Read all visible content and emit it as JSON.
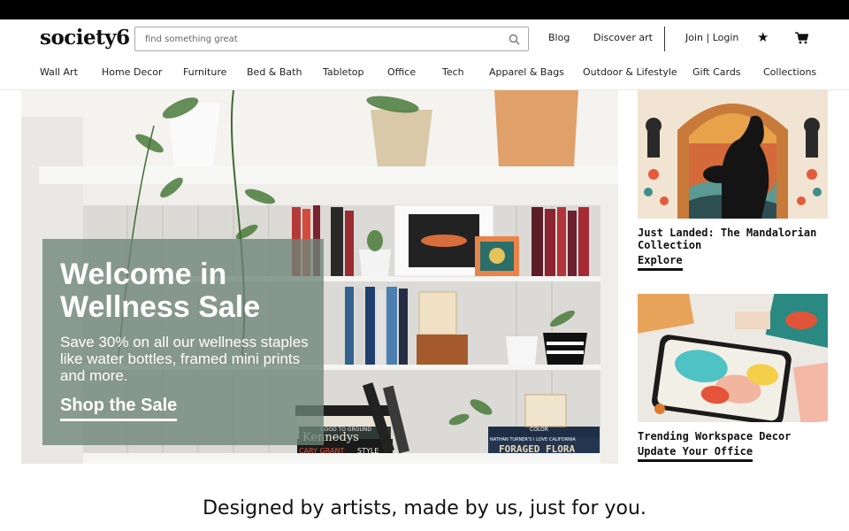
{
  "header": {
    "logo": "society6",
    "search_placeholder": "find something great",
    "links": {
      "blog": "Blog",
      "discover": "Discover art",
      "join": "Join | Login"
    }
  },
  "nav": {
    "items": [
      "Wall Art",
      "Home Decor",
      "Furniture",
      "Bed & Bath",
      "Tabletop",
      "Office",
      "Tech",
      "Apparel & Bags",
      "Outdoor & Lifestyle",
      "Gift Cards",
      "Collections"
    ]
  },
  "hero": {
    "title": "Welcome in Wellness Sale",
    "subtitle": "Save 30% on all our wellness staples like water bottles, framed mini prints and more.",
    "cta": "Shop the Sale",
    "book_labels": [
      "GOOD TO GROUND",
      "Kennedys",
      "CARY GRANT",
      "STYLE",
      "NATHAN TURNER'S I LOVE CALIFORNIA",
      "FORAGED FLORA",
      "COLOR"
    ]
  },
  "promos": [
    {
      "title": "Just Landed: The Mandalorian Collection",
      "link": "Explore"
    },
    {
      "title": "Trending Workspace Decor",
      "link": "Update Your Office"
    }
  ],
  "tagline": "Designed by artists, made by us, just for you.",
  "colors": {
    "overlay": "#6e8478",
    "topbar": "#000000"
  }
}
